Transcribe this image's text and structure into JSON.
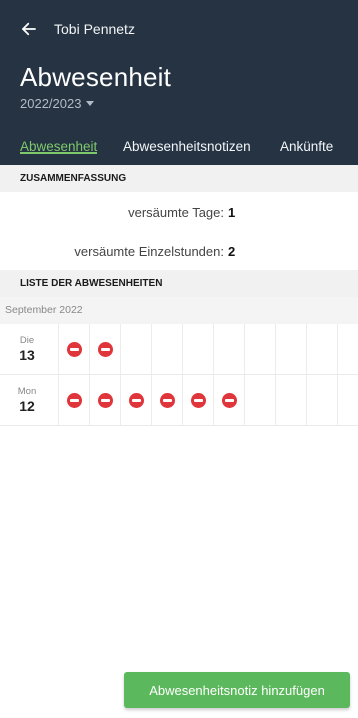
{
  "header": {
    "user_name": "Tobi Pennetz",
    "title": "Abwesenheit",
    "school_year": "2022/2023",
    "colors": {
      "background": "#253343",
      "accent": "#7ec96b"
    }
  },
  "tabs": [
    {
      "label": "Abwesenheit",
      "active": true
    },
    {
      "label": "Abwesenheitsnotizen",
      "active": false
    },
    {
      "label": "Ankünfte",
      "active": false
    }
  ],
  "summary": {
    "heading": "ZUSAMMENFASSUNG",
    "missed_days_label": "versäumte Tage:",
    "missed_days_value": "1",
    "missed_lessons_label": "versäumte Einzelstunden:",
    "missed_lessons_value": "2"
  },
  "absence_list": {
    "heading": "LISTE DER ABWESENHEITEN",
    "month": "September 2022",
    "days": [
      {
        "weekday": "Die",
        "day": "13",
        "absent_lessons": 2
      },
      {
        "weekday": "Mon",
        "day": "12",
        "absent_lessons": 6
      }
    ],
    "absent_color": "#e0353b"
  },
  "actions": {
    "add_note_label": "Abwesenheitsnotiz hinzufügen",
    "button_color": "#5cb85c"
  }
}
